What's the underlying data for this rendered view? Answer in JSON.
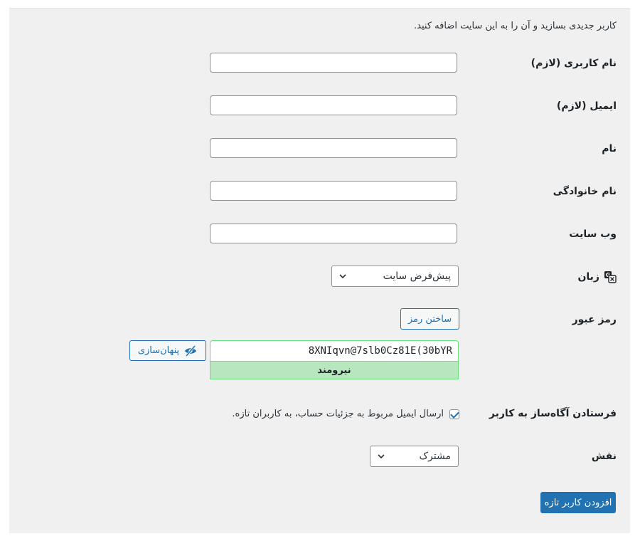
{
  "intro": "کاربر جدیدی بسازید و آن را به این سایت اضافه کنید.",
  "fields": {
    "username": {
      "label": "نام کاربری (لازم)",
      "value": ""
    },
    "email": {
      "label": "ایمیل (لازم)",
      "value": ""
    },
    "first_name": {
      "label": "نام",
      "value": ""
    },
    "last_name": {
      "label": "نام خانوادگی",
      "value": ""
    },
    "website": {
      "label": "وب سایت",
      "value": ""
    }
  },
  "language": {
    "label": "زبان",
    "selected": "پیش‌فرض سایت",
    "icon": "translation-icon"
  },
  "password": {
    "label": "رمز عبور",
    "generate_label": "ساختن رمز",
    "value": "8XNIqvn@7slb0Cz81E(30bYR",
    "hide_label": "پنهان‌سازی",
    "hide_icon": "eye-slash-icon",
    "strength": "نیرومند",
    "strength_color": "#b8e6bf"
  },
  "notification": {
    "label": "فرستادن آگاه‌ساز به کاربر",
    "checkbox_text": "ارسال ایمیل مربوط به جزئیات حساب، به کاربران تازه.",
    "checked": true
  },
  "role": {
    "label": "نقش",
    "selected": "مشترک"
  },
  "submit_label": "افزودن کاربر تازه",
  "colors": {
    "accent": "#2271b1",
    "background": "#f0f0f1"
  }
}
